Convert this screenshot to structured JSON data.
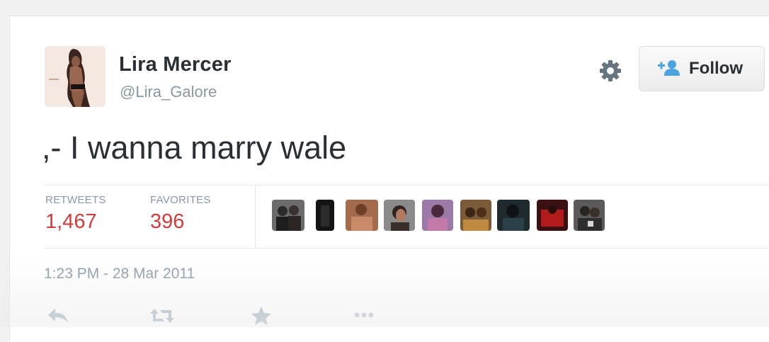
{
  "profile": {
    "name": "Lira Mercer",
    "handle": "@Lira_Galore"
  },
  "header": {
    "follow_label": "Follow"
  },
  "tweet": {
    "text": ",- I wanna marry wale",
    "timestamp": "1:23 PM - 28 Mar 2011"
  },
  "stats": {
    "retweets_label": "RETWEETS",
    "retweets_count": "1,467",
    "favorites_label": "FAVORITES",
    "favorites_count": "396"
  },
  "favoriters_count_shown": 9,
  "actions": [
    "reply-icon",
    "retweet-icon",
    "favorite-icon",
    "more-icon"
  ],
  "colors": {
    "count_red": "#d33a3a",
    "follow_icon_blue": "#4ba3e0",
    "muted_gray": "#8899a6",
    "text_dark": "#292f33"
  }
}
